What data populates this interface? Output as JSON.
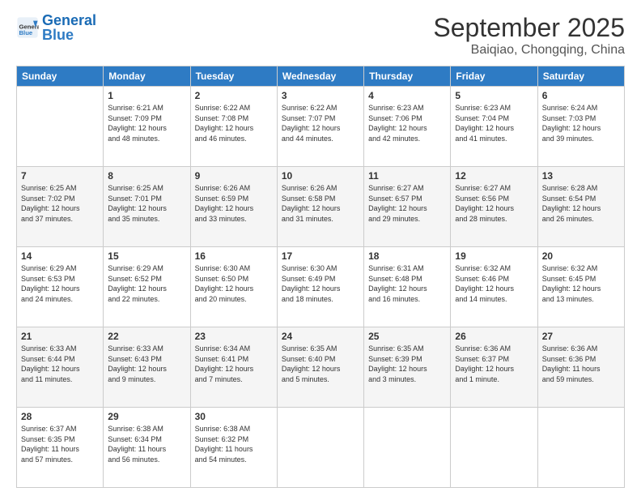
{
  "header": {
    "logo_general": "General",
    "logo_blue": "Blue",
    "month": "September 2025",
    "location": "Baiqiao, Chongqing, China"
  },
  "weekdays": [
    "Sunday",
    "Monday",
    "Tuesday",
    "Wednesday",
    "Thursday",
    "Friday",
    "Saturday"
  ],
  "weeks": [
    [
      {
        "day": "",
        "info": ""
      },
      {
        "day": "1",
        "info": "Sunrise: 6:21 AM\nSunset: 7:09 PM\nDaylight: 12 hours\nand 48 minutes."
      },
      {
        "day": "2",
        "info": "Sunrise: 6:22 AM\nSunset: 7:08 PM\nDaylight: 12 hours\nand 46 minutes."
      },
      {
        "day": "3",
        "info": "Sunrise: 6:22 AM\nSunset: 7:07 PM\nDaylight: 12 hours\nand 44 minutes."
      },
      {
        "day": "4",
        "info": "Sunrise: 6:23 AM\nSunset: 7:06 PM\nDaylight: 12 hours\nand 42 minutes."
      },
      {
        "day": "5",
        "info": "Sunrise: 6:23 AM\nSunset: 7:04 PM\nDaylight: 12 hours\nand 41 minutes."
      },
      {
        "day": "6",
        "info": "Sunrise: 6:24 AM\nSunset: 7:03 PM\nDaylight: 12 hours\nand 39 minutes."
      }
    ],
    [
      {
        "day": "7",
        "info": "Sunrise: 6:25 AM\nSunset: 7:02 PM\nDaylight: 12 hours\nand 37 minutes."
      },
      {
        "day": "8",
        "info": "Sunrise: 6:25 AM\nSunset: 7:01 PM\nDaylight: 12 hours\nand 35 minutes."
      },
      {
        "day": "9",
        "info": "Sunrise: 6:26 AM\nSunset: 6:59 PM\nDaylight: 12 hours\nand 33 minutes."
      },
      {
        "day": "10",
        "info": "Sunrise: 6:26 AM\nSunset: 6:58 PM\nDaylight: 12 hours\nand 31 minutes."
      },
      {
        "day": "11",
        "info": "Sunrise: 6:27 AM\nSunset: 6:57 PM\nDaylight: 12 hours\nand 29 minutes."
      },
      {
        "day": "12",
        "info": "Sunrise: 6:27 AM\nSunset: 6:56 PM\nDaylight: 12 hours\nand 28 minutes."
      },
      {
        "day": "13",
        "info": "Sunrise: 6:28 AM\nSunset: 6:54 PM\nDaylight: 12 hours\nand 26 minutes."
      }
    ],
    [
      {
        "day": "14",
        "info": "Sunrise: 6:29 AM\nSunset: 6:53 PM\nDaylight: 12 hours\nand 24 minutes."
      },
      {
        "day": "15",
        "info": "Sunrise: 6:29 AM\nSunset: 6:52 PM\nDaylight: 12 hours\nand 22 minutes."
      },
      {
        "day": "16",
        "info": "Sunrise: 6:30 AM\nSunset: 6:50 PM\nDaylight: 12 hours\nand 20 minutes."
      },
      {
        "day": "17",
        "info": "Sunrise: 6:30 AM\nSunset: 6:49 PM\nDaylight: 12 hours\nand 18 minutes."
      },
      {
        "day": "18",
        "info": "Sunrise: 6:31 AM\nSunset: 6:48 PM\nDaylight: 12 hours\nand 16 minutes."
      },
      {
        "day": "19",
        "info": "Sunrise: 6:32 AM\nSunset: 6:46 PM\nDaylight: 12 hours\nand 14 minutes."
      },
      {
        "day": "20",
        "info": "Sunrise: 6:32 AM\nSunset: 6:45 PM\nDaylight: 12 hours\nand 13 minutes."
      }
    ],
    [
      {
        "day": "21",
        "info": "Sunrise: 6:33 AM\nSunset: 6:44 PM\nDaylight: 12 hours\nand 11 minutes."
      },
      {
        "day": "22",
        "info": "Sunrise: 6:33 AM\nSunset: 6:43 PM\nDaylight: 12 hours\nand 9 minutes."
      },
      {
        "day": "23",
        "info": "Sunrise: 6:34 AM\nSunset: 6:41 PM\nDaylight: 12 hours\nand 7 minutes."
      },
      {
        "day": "24",
        "info": "Sunrise: 6:35 AM\nSunset: 6:40 PM\nDaylight: 12 hours\nand 5 minutes."
      },
      {
        "day": "25",
        "info": "Sunrise: 6:35 AM\nSunset: 6:39 PM\nDaylight: 12 hours\nand 3 minutes."
      },
      {
        "day": "26",
        "info": "Sunrise: 6:36 AM\nSunset: 6:37 PM\nDaylight: 12 hours\nand 1 minute."
      },
      {
        "day": "27",
        "info": "Sunrise: 6:36 AM\nSunset: 6:36 PM\nDaylight: 11 hours\nand 59 minutes."
      }
    ],
    [
      {
        "day": "28",
        "info": "Sunrise: 6:37 AM\nSunset: 6:35 PM\nDaylight: 11 hours\nand 57 minutes."
      },
      {
        "day": "29",
        "info": "Sunrise: 6:38 AM\nSunset: 6:34 PM\nDaylight: 11 hours\nand 56 minutes."
      },
      {
        "day": "30",
        "info": "Sunrise: 6:38 AM\nSunset: 6:32 PM\nDaylight: 11 hours\nand 54 minutes."
      },
      {
        "day": "",
        "info": ""
      },
      {
        "day": "",
        "info": ""
      },
      {
        "day": "",
        "info": ""
      },
      {
        "day": "",
        "info": ""
      }
    ]
  ]
}
